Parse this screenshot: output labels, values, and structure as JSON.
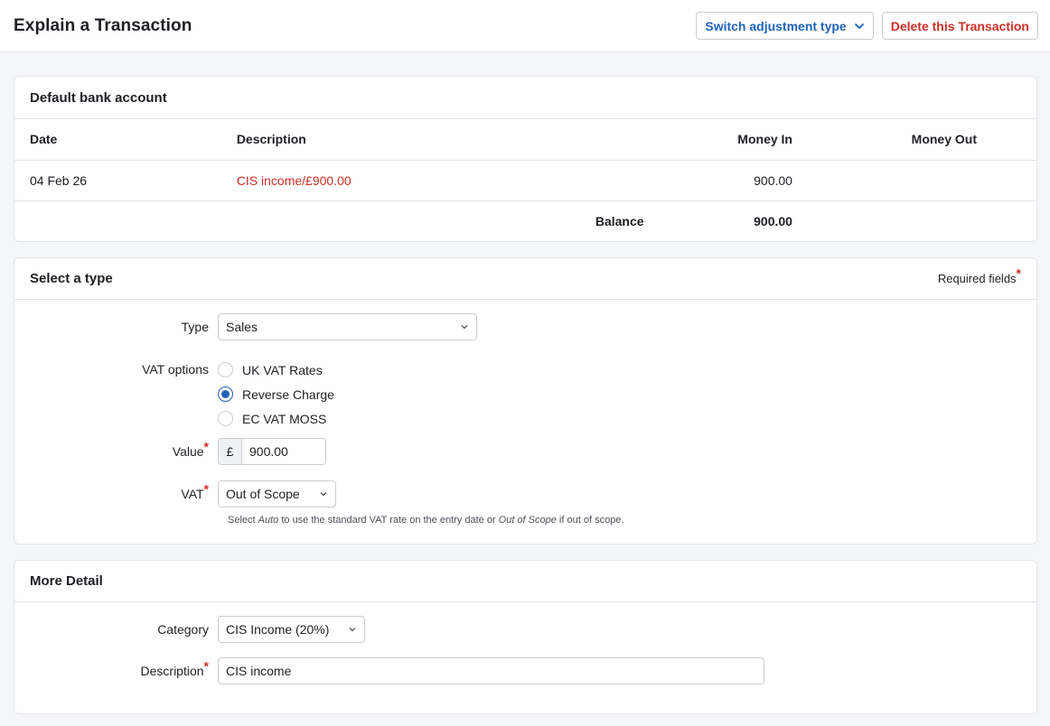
{
  "header": {
    "title": "Explain a Transaction",
    "switch_label": "Switch adjustment type",
    "delete_label": "Delete this Transaction"
  },
  "bank": {
    "title": "Default bank account",
    "columns": {
      "date": "Date",
      "description": "Description",
      "money_in": "Money In",
      "money_out": "Money Out"
    },
    "row": {
      "date": "04 Feb 26",
      "description": "CIS income/£900.00",
      "money_in": "900.00",
      "money_out": ""
    },
    "balance_label": "Balance",
    "balance_value": "900.00"
  },
  "type_section": {
    "title": "Select a type",
    "required_note": "Required fields",
    "type_label": "Type",
    "type_value": "Sales",
    "vat_options_label": "VAT options",
    "vat_options": [
      "UK VAT Rates",
      "Reverse Charge",
      "EC VAT MOSS"
    ],
    "vat_selected": "Reverse Charge",
    "value_label": "Value",
    "currency_symbol": "£",
    "value": "900.00",
    "vat_label": "VAT",
    "vat_value": "Out of Scope",
    "hint_pre": "Select ",
    "hint_auto": "Auto",
    "hint_mid": " to use the standard VAT rate on the entry date or ",
    "hint_oos": "Out of Scope",
    "hint_post": " if out of scope."
  },
  "more_detail": {
    "title": "More Detail",
    "category_label": "Category",
    "category_value": "CIS Income (20%)",
    "description_label": "Description",
    "description_value": "CIS income"
  },
  "colors": {
    "accent": "#1f63b8",
    "danger": "#cf2f26",
    "border": "#e3e5e9",
    "background": "#f5f6f8"
  }
}
